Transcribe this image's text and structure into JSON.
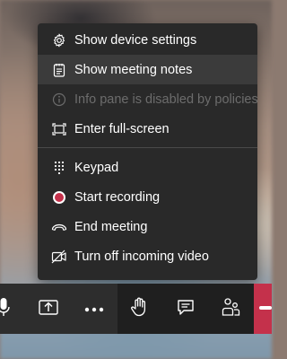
{
  "menu": {
    "items": [
      {
        "label": "Show device settings",
        "icon": "gear-icon"
      },
      {
        "label": "Show meeting notes",
        "icon": "notes-icon"
      },
      {
        "label": "Info pane is disabled by policies",
        "icon": "info-icon"
      },
      {
        "label": "Enter full-screen",
        "icon": "fullscreen-icon"
      },
      {
        "label": "Keypad",
        "icon": "keypad-icon"
      },
      {
        "label": "Start recording",
        "icon": "record-icon"
      },
      {
        "label": "End meeting",
        "icon": "end-call-icon"
      },
      {
        "label": "Turn off incoming video",
        "icon": "video-off-icon"
      }
    ],
    "hovered_item": "Show meeting notes",
    "disabled_item": "Info pane is disabled by policies"
  },
  "toolbar": {
    "buttons": [
      "microphone-icon",
      "share-screen-icon",
      "more-options-icon",
      "raise-hand-icon",
      "chat-icon",
      "participants-icon",
      "hang-up-icon"
    ]
  },
  "colors": {
    "menu_bg": "#292929",
    "hover_bg": "#3b3b3b",
    "disabled_text": "#6c6c6c",
    "record_red": "#c4314b",
    "leave_red": "#c4314b"
  }
}
